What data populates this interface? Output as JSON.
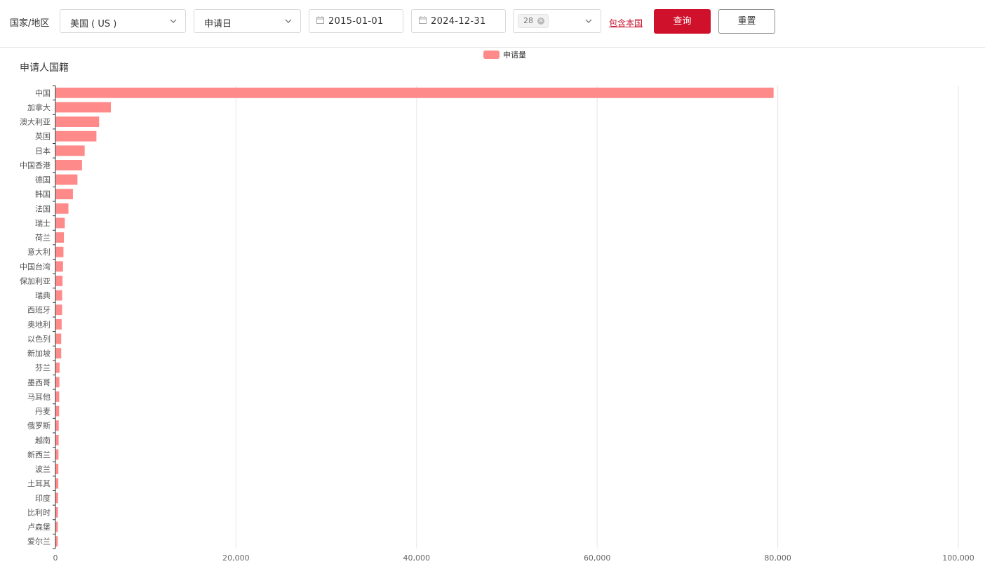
{
  "filters": {
    "region_label": "国家/地区",
    "country_select": "美国 ( US )",
    "date_type_select": "申请日",
    "start_date": "2015-01-01",
    "end_date": "2024-12-31",
    "count_tag": "28",
    "include_home_link": "包含本国",
    "query_button": "查询",
    "reset_button": "重置"
  },
  "colors": {
    "bar": "#ff8a8a",
    "primary": "#d0112b"
  },
  "chart_data": {
    "type": "bar",
    "orientation": "horizontal",
    "title": "申请人国籍",
    "legend": [
      "申请量"
    ],
    "legend_position": "top-center",
    "grid": true,
    "xlim": [
      0,
      100000
    ],
    "x_ticks": [
      "0",
      "20,000",
      "40,000",
      "60,000",
      "80,000",
      "100,000"
    ],
    "categories": [
      "中国",
      "加拿大",
      "澳大利亚",
      "英国",
      "日本",
      "中国香港",
      "德国",
      "韩国",
      "法国",
      "瑞士",
      "荷兰",
      "意大利",
      "中国台湾",
      "保加利亚",
      "瑞典",
      "西班牙",
      "奥地利",
      "以色列",
      "新加坡",
      "芬兰",
      "墨西哥",
      "马耳他",
      "丹麦",
      "俄罗斯",
      "越南",
      "新西兰",
      "波兰",
      "土耳其",
      "印度",
      "比利时",
      "卢森堡",
      "爱尔兰"
    ],
    "series": [
      {
        "name": "申请量",
        "values": [
          79500,
          6100,
          4800,
          4500,
          3200,
          2900,
          2400,
          1900,
          1400,
          1000,
          900,
          850,
          800,
          750,
          700,
          700,
          650,
          600,
          600,
          420,
          400,
          380,
          370,
          330,
          320,
          300,
          290,
          280,
          260,
          240,
          230,
          220
        ]
      }
    ]
  }
}
